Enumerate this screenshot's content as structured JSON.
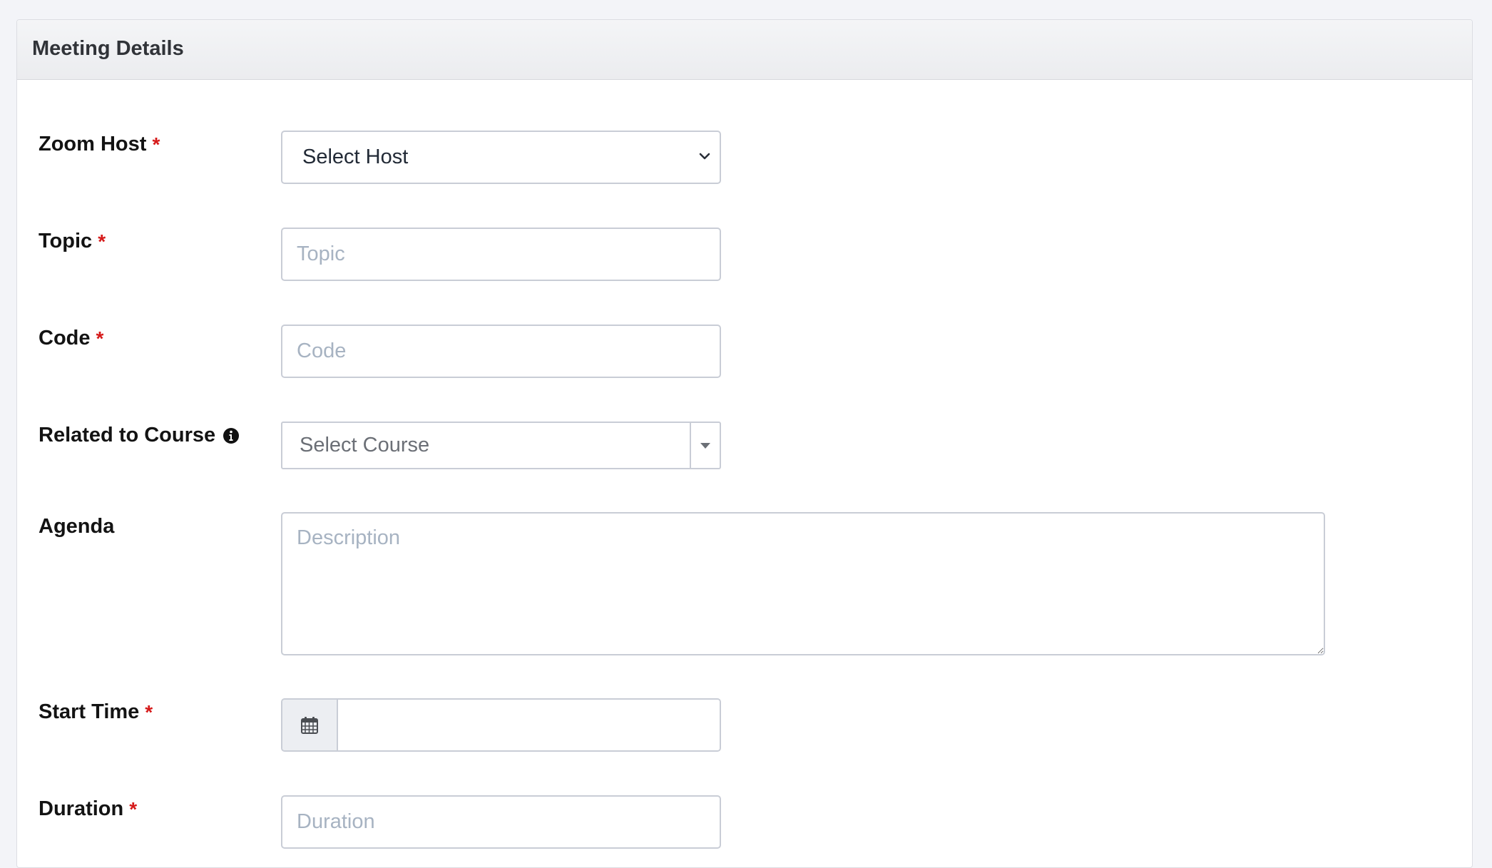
{
  "panel": {
    "title": "Meeting Details"
  },
  "fields": {
    "zoom_host": {
      "label": "Zoom Host",
      "required_mark": "*",
      "selected_value": "Select Host"
    },
    "topic": {
      "label": "Topic",
      "required_mark": "*",
      "placeholder": "Topic"
    },
    "code": {
      "label": "Code",
      "required_mark": "*",
      "placeholder": "Code"
    },
    "related_course": {
      "label": "Related to Course",
      "selected_value": "Select Course",
      "icon": "info-circle-icon"
    },
    "agenda": {
      "label": "Agenda",
      "placeholder": "Description"
    },
    "start_time": {
      "label": "Start Time",
      "required_mark": "*",
      "icon": "calendar-icon",
      "value": ""
    },
    "duration": {
      "label": "Duration",
      "required_mark": "*",
      "placeholder": "Duration"
    }
  },
  "colors": {
    "required": "#d61a1a",
    "border": "#c9cdd6",
    "placeholder": "#a7b3c2",
    "header_bg": "#eceef1"
  }
}
